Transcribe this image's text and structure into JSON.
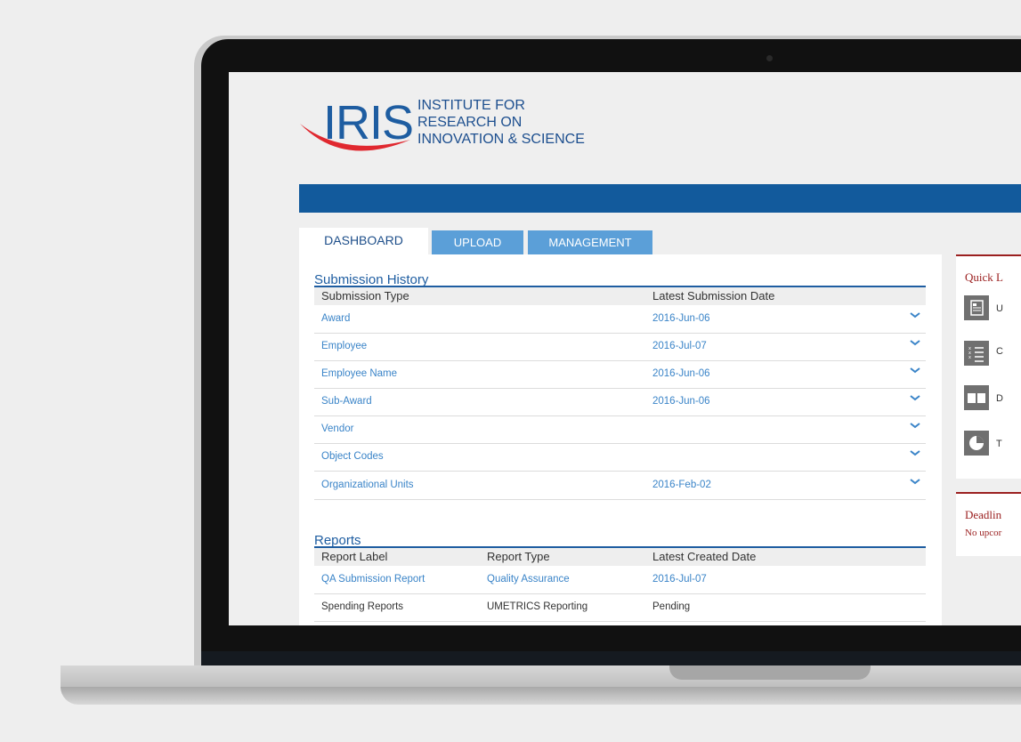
{
  "logo": {
    "mark": "IRIS",
    "tagline": [
      "INSTITUTE FOR",
      "RESEARCH ON",
      "INNOVATION & SCIENCE"
    ]
  },
  "tabs": [
    "DASHBOARD",
    "UPLOAD",
    "MANAGEMENT"
  ],
  "submission_history": {
    "title": "Submission History",
    "columns": [
      "Submission Type",
      "Latest Submission Date"
    ],
    "rows": [
      {
        "type": "Award",
        "date": "2016-Jun-06"
      },
      {
        "type": "Employee",
        "date": "2016-Jul-07"
      },
      {
        "type": "Employee Name",
        "date": "2016-Jun-06"
      },
      {
        "type": "Sub-Award",
        "date": "2016-Jun-06"
      },
      {
        "type": "Vendor",
        "date": ""
      },
      {
        "type": "Object Codes",
        "date": ""
      },
      {
        "type": "Organizational Units",
        "date": "2016-Feb-02"
      }
    ]
  },
  "reports": {
    "title": "Reports",
    "columns": [
      "Report Label",
      "Report Type",
      "Latest Created Date"
    ],
    "rows": [
      {
        "label": "QA Submission Report",
        "type": "Quality Assurance",
        "date": "2016-Jul-07"
      },
      {
        "label": "Spending Reports",
        "type": "UMETRICS Reporting",
        "date": "Pending"
      }
    ]
  },
  "quick_links": {
    "title": "Quick L",
    "items": [
      {
        "icon": "document-icon",
        "label": "U"
      },
      {
        "icon": "checklist-icon",
        "label": "C"
      },
      {
        "icon": "book-icon",
        "label": "D"
      },
      {
        "icon": "pie-chart-icon",
        "label": "T"
      }
    ]
  },
  "deadlines": {
    "title": "Deadlin",
    "text": "No upcor"
  },
  "colors": {
    "brand_blue": "#125a9c",
    "tab_blue": "#5b9fd8",
    "link_blue": "#3a84c8",
    "accent_red": "#9b2020"
  }
}
